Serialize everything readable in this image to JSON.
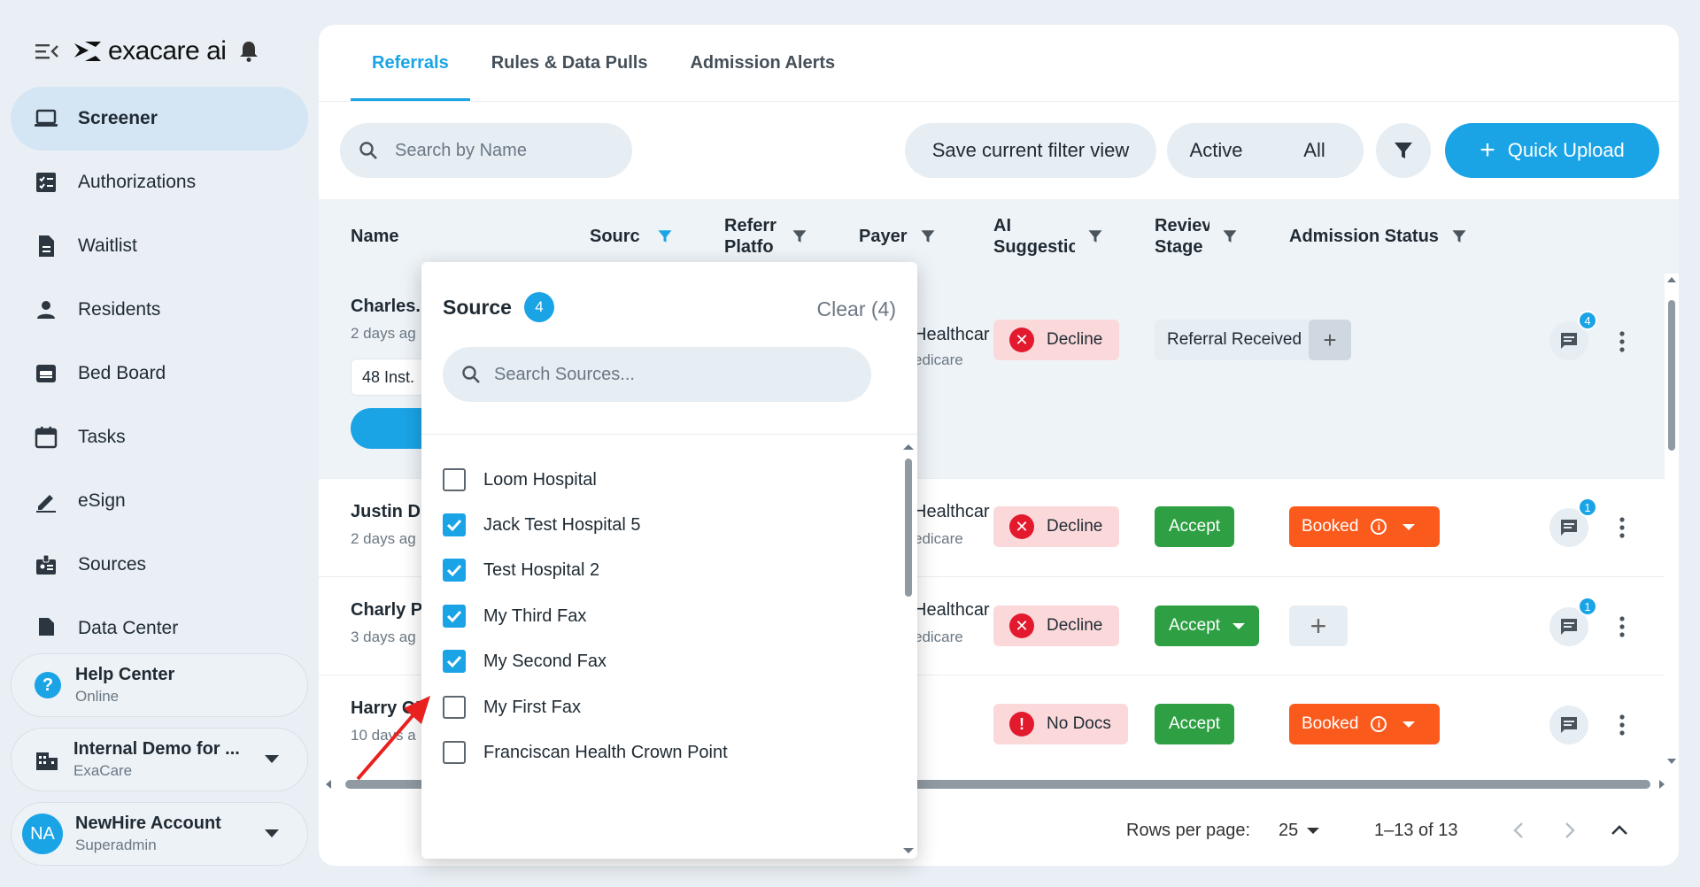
{
  "app": {
    "brand": "exacare ai"
  },
  "sidebar": {
    "items": [
      {
        "label": "Screener",
        "icon": "laptop-icon",
        "active": true
      },
      {
        "label": "Authorizations",
        "icon": "checklist-icon"
      },
      {
        "label": "Waitlist",
        "icon": "document-icon"
      },
      {
        "label": "Residents",
        "icon": "person-icon"
      },
      {
        "label": "Bed Board",
        "icon": "bed-icon"
      },
      {
        "label": "Tasks",
        "icon": "calendar-icon"
      },
      {
        "label": "eSign",
        "icon": "pen-icon"
      },
      {
        "label": "Sources",
        "icon": "badge-icon"
      },
      {
        "label": "Data Center",
        "icon": "database-icon"
      }
    ],
    "help": {
      "title": "Help Center",
      "status": "Online"
    },
    "org": {
      "title": "Internal Demo for ...",
      "subtitle": "ExaCare"
    },
    "account": {
      "initials": "NA",
      "title": "NewHire Account",
      "role": "Superadmin"
    }
  },
  "tabs": [
    {
      "label": "Referrals",
      "active": true
    },
    {
      "label": "Rules & Data Pulls"
    },
    {
      "label": "Admission Alerts"
    }
  ],
  "toolbar": {
    "search_placeholder": "Search by Name",
    "save_filter_label": "Save current filter view",
    "toggle_active": "Active",
    "toggle_all": "All",
    "quick_upload_label": "Quick Upload"
  },
  "table": {
    "columns": [
      "Name",
      "Source",
      "Referral Platform",
      "Payer",
      "AI Suggestion",
      "Review Stage",
      "Admission Status"
    ],
    "column_display": [
      "Name",
      "Sourc",
      "Referr\nPlatfo",
      "Payer",
      "AI\nSuggestic",
      "Reviev\nStage",
      "Admission Status"
    ],
    "rows": [
      {
        "name": "Charles.",
        "ago": "2 days ag",
        "inst": "48 Inst.",
        "payer": "Healthcar",
        "plan": "edicare",
        "ai": "Decline",
        "review": "Referral Received",
        "comments": "4"
      },
      {
        "name": "Justin D",
        "ago": "2 days ag",
        "payer": "Healthcar",
        "plan": "edicare",
        "ai": "Decline",
        "review": "Accept",
        "admission": "Booked",
        "comments": "1"
      },
      {
        "name": "Charly P",
        "ago": "3 days ag",
        "payer": "Healthcar",
        "plan": "edicare",
        "ai": "Decline",
        "review": "Accept",
        "comments": "1"
      },
      {
        "name": "Harry O'l",
        "ago": "10 days a",
        "ai": "No Docs",
        "review": "Accept",
        "admission": "Booked"
      }
    ]
  },
  "pagination": {
    "rows_per_page_label": "Rows per page:",
    "rows_per_page": "25",
    "range": "1–13 of 13"
  },
  "source_filter": {
    "title": "Source",
    "count": "4",
    "clear_label": "Clear (4)",
    "search_placeholder": "Search Sources...",
    "options": [
      {
        "label": "Loom Hospital",
        "checked": false
      },
      {
        "label": "Jack Test Hospital 5",
        "checked": true
      },
      {
        "label": "Test Hospital 2",
        "checked": true
      },
      {
        "label": "My Third Fax",
        "checked": true
      },
      {
        "label": "My Second Fax",
        "checked": true
      },
      {
        "label": "My First Fax",
        "checked": false
      },
      {
        "label": "Franciscan Health Crown Point",
        "checked": false
      }
    ]
  },
  "colors": {
    "accent": "#1aa4e6",
    "accept": "#2ea043",
    "booked": "#fb5a1d",
    "decline_bg": "#fbd9da",
    "annotation_arrow": "#e8201e"
  }
}
